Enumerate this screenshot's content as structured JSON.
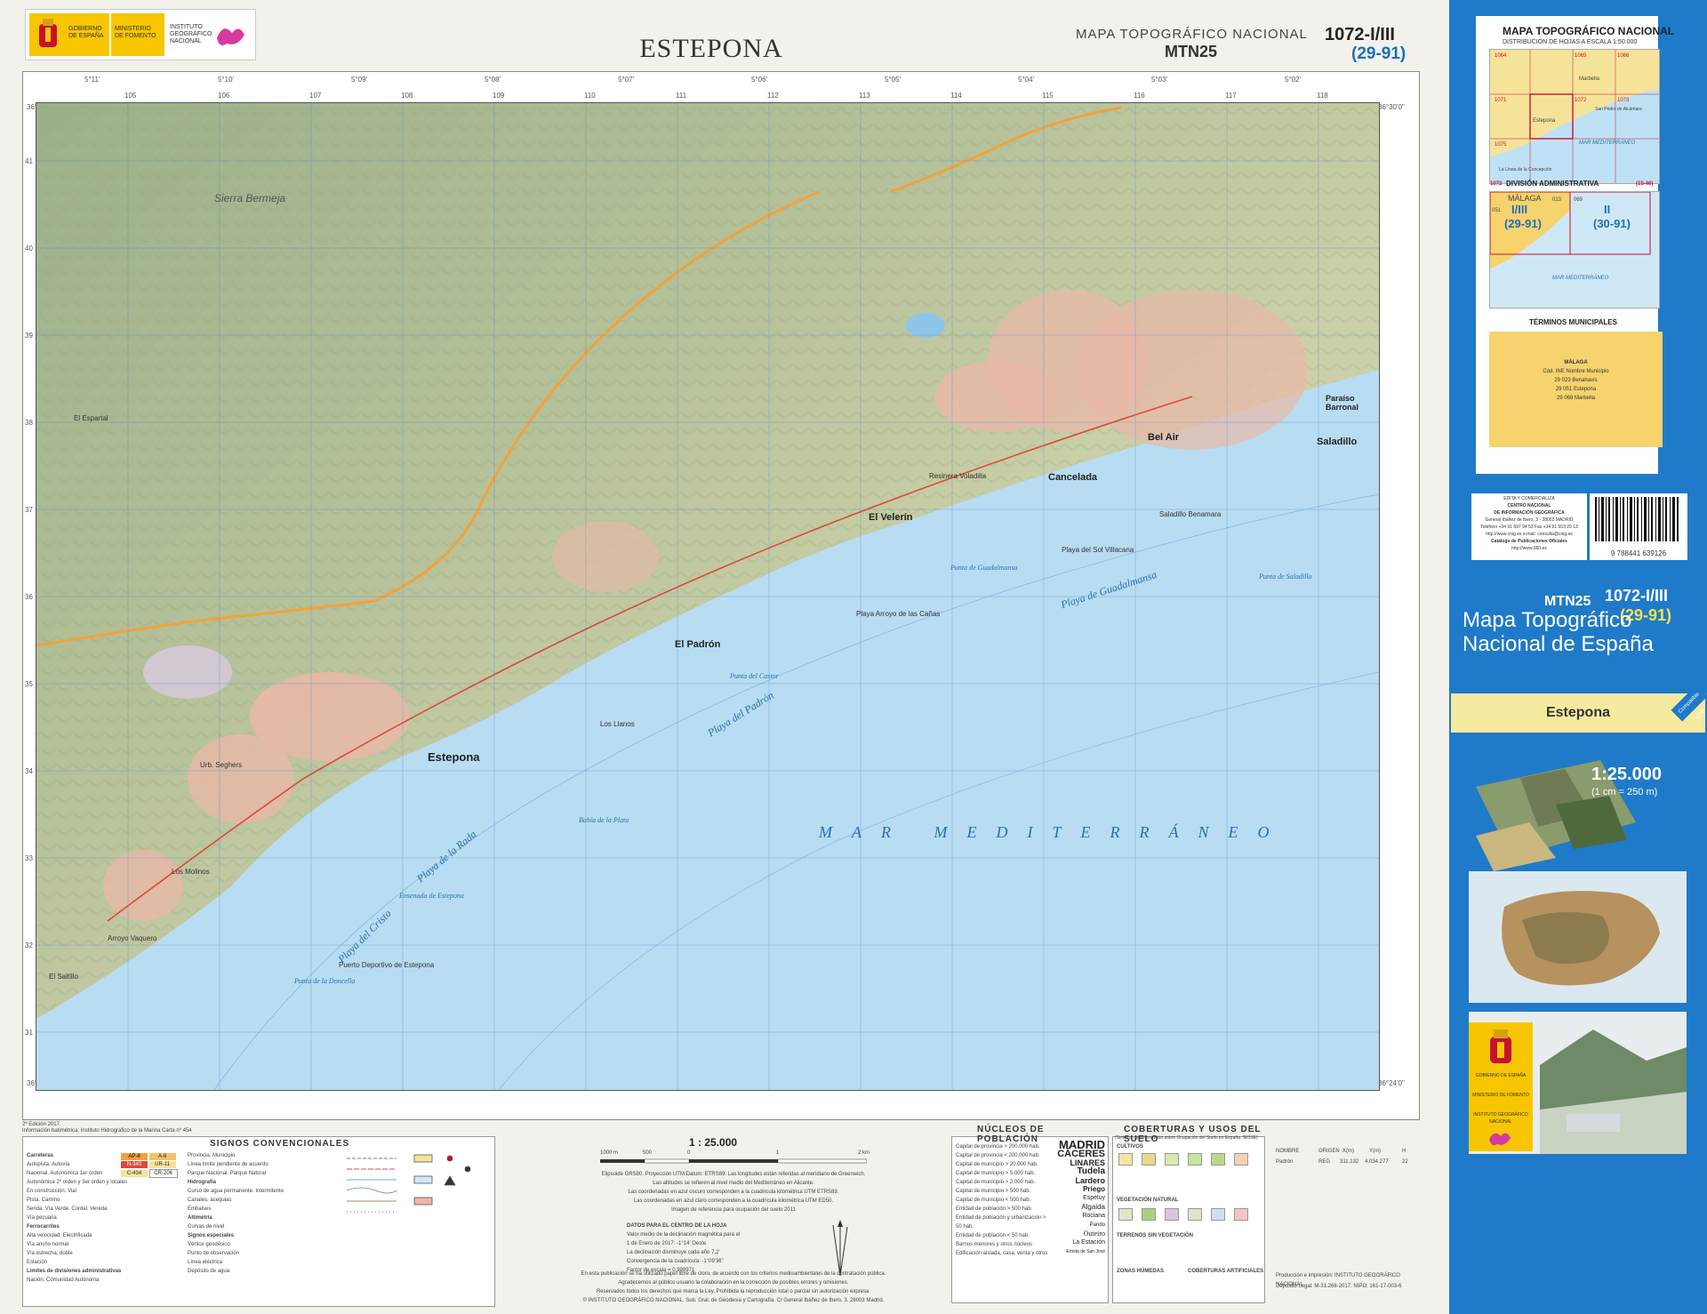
{
  "header": {
    "gov_line1": "GOBIERNO",
    "gov_line2": "DE ESPAÑA",
    "ministry": "MINISTERIO DE FOMENTO",
    "ign_line1": "INSTITUTO",
    "ign_line2": "GEOGRÁFICO",
    "ign_line3": "NACIONAL",
    "title": "ESTEPONA",
    "series_title": "MAPA TOPOGRÁFICO NACIONAL",
    "series_code": "MTN25",
    "sheet_number": "1072-I/III",
    "sheet_sub": "(29-91)"
  },
  "map": {
    "top_ticks": [
      "5°11'",
      "5°10'",
      "5°09'",
      "5°08'",
      "5°07'",
      "5°06'",
      "5°05'",
      "5°04'",
      "5°03'",
      "5°02'"
    ],
    "utm_top": [
      "105",
      "106",
      "107",
      "108",
      "109",
      "110",
      "111",
      "112",
      "113",
      "114",
      "115",
      "116",
      "117",
      "118"
    ],
    "left_ticks": [
      "41",
      "40",
      "39",
      "38",
      "37",
      "36",
      "35",
      "34",
      "33",
      "32",
      "31"
    ],
    "corner_tl": "36°30'0\"",
    "corner_tr": "36°30'0\"",
    "corner_bl": "36°24'0\"",
    "corner_br": "36°24'0\"",
    "places": [
      "Estepona",
      "El Padrón",
      "El Velerín",
      "Cancelada",
      "Bel Air",
      "Saladillo",
      "Resinera Voladilla",
      "Playa del Sol Villacana",
      "Saladillo Benamara",
      "Puerto Deportivo de Estepona",
      "Bahía de la Plata",
      "Punta del Castor",
      "Playa Arroyo de las Cañas",
      "Punta de Guadalmansa",
      "Los Llanos",
      "Ensenada de Estepona",
      "Urb. Seghers",
      "El Saltillo",
      "Arroyo Vaquero",
      "Paraíso Barronal",
      "Punta de Saladillo",
      "Punta de la Doncella",
      "Sierra Bermeja",
      "El Espartal",
      "Los Molinos"
    ],
    "sea_label": "MAR MEDITERRÁNEO",
    "playa_labels": [
      "Playa del Padrón",
      "Playa de Guadalmansa",
      "Playa de la Rada",
      "Playa del Cristo"
    ]
  },
  "legend": {
    "edition": "2ª Edición 2017.",
    "edition_note": "Información batimétrica: Instituto Hidrográfico de la Marina Carta nº 454",
    "signos_title": "SIGNOS CONVENCIONALES",
    "signos_left": [
      "Carreteras",
      "Autopista. Autovía",
      "Nacional. Autonómica 1er orden",
      "Autonómica 2º orden y 3er orden y locales",
      "En construcción. Vial",
      "Pista. Camino",
      "Senda. Vía Verde. Cordel. Vereda",
      "Vía pecuaria",
      "Ferrocarriles",
      "Alta velocidad. Electrificada",
      "Vía ancho normal",
      "Vía estrecha, doble",
      "Estación",
      "Límites de divisiones administrativas",
      "Nación. Comunidad Autónoma"
    ],
    "signos_mid": [
      "Provincia. Municipio",
      "Línea límite pendiente de acuerdo",
      "Parque Nacional. Parque Natural",
      "Hidrografía",
      "Curso de agua permanente. Intermitente",
      "Canales, acequias",
      "Embalses",
      "Altimetría",
      "Curvas de nivel",
      "Signos especiales",
      "Vértice geodésico",
      "Punto de observación",
      "Línea eléctrica",
      "Depósito de agua"
    ],
    "road_codes": [
      "AP-8",
      "A-8",
      "N-340",
      "UR-11",
      "C-434",
      "CR-206"
    ],
    "scale_title": "1 : 25.000",
    "scale_ticks": [
      "1000 m",
      "500",
      "0",
      "1",
      "2 km"
    ],
    "datum_text": [
      "Elipsoide GRS80. Proyección UTM Datum: ETRS89. Las longitudes están referidas al meridiano de Greenwich.",
      "Las altitudes se refieren al nivel medio del Mediterráneo en Alicante.",
      "Las coordenadas en azul oscuro corresponden a la cuadrícula kilométrica UTM ETRS89.",
      "Las coordenadas en azul claro corresponden a la cuadrícula kilométrica UTM ED50.",
      "Imagen de referencia para ocupación del suelo 2011"
    ],
    "magnetic_title": "DATOS PARA EL CENTRO DE LA HOJA",
    "magnetic_text": [
      "Valor medio de la declinación magnética para el",
      "1 de Enero de 2017: -1°14' Oeste",
      "La declinación disminuye cada año 7,2'",
      "Convergencia de la cuadrícula: -1°09'36\"",
      "Factor de escala = 0,999971"
    ],
    "publication_note": "En esta publicación se ha utilizado papel libre de cloro, de acuerdo con los criterios medioambientales de la contratación pública.",
    "thanks": "Agradecemos al público usuario la colaboración en la corrección de posibles errores y omisiones.",
    "rights": "Reservados todos los derechos que marca la Ley. Prohibida la reproducción total o parcial sin autorización expresa.",
    "copyright": "© INSTITUTO GEOGRÁFICO NACIONAL. Sub. Gral. de Geodesia y Cartografía. C/ General Ibáñez de Ibero, 3. 28003 Madrid.",
    "nucleos_title": "NÚCLEOS DE POBLACIÓN",
    "nucleos_rows": [
      "Capital de provincia > 200.000 hab.",
      "Capital de provincia < 200.000 hab.",
      "Capital de municipio > 20.000 hab.",
      "Capital de municipio > 5.000 hab.",
      "Capital de municipio > 2.000 hab.",
      "Capital de municipio > 500 hab.",
      "Capital de municipio < 500 hab.",
      "Entidad de población > 500 hab.",
      "Entidad de población y urbanización > 50 hab.",
      "Entidad de población < 50 hab.",
      "Barrios menores y otros núcleos",
      "Edificación aislada, casa, venta y otros"
    ],
    "nucleos_names": [
      "MADRID",
      "CÁCERES",
      "LINARES",
      "Tudela",
      "Lardero",
      "Priego",
      "Espeluy",
      "Algaida",
      "Rociana",
      "Pando",
      "Outeiro",
      "La Estación",
      "Ermita de San José"
    ],
    "cob_title": "COBERTURAS Y USOS DEL SUELO",
    "cob_sub": "(Sistema de Información sobre Ocupación del Suelo en España. SIOSE)",
    "cob_sections": [
      "CULTIVOS",
      "VEGETACIÓN NATURAL",
      "TERRENOS SIN VEGETACIÓN",
      "ZONAS HÚMEDAS",
      "COBERTURAS ARTIFICIALES"
    ],
    "cob_colors": [
      "#f3e6a5",
      "#e9d98a",
      "#d9e8b0",
      "#c9e3a2",
      "#b8d98b",
      "#f2d2b8",
      "#dfe8c6",
      "#a9d27f",
      "#d7c6e0",
      "#e8e0cf",
      "#cde0ef",
      "#f4c6c6"
    ],
    "nombre_headers": [
      "NOMBRE",
      "ORIGEN",
      "X(m)",
      "Y(m)",
      "H"
    ],
    "nombre_row": [
      "Padrón",
      "REG",
      "311.132",
      "4.034.277",
      "22"
    ],
    "production": "Producción e impresión: INSTITUTO GEOGRÁFICO NACIONAL",
    "deposito": "Depósito Legal: M-31.268-2017. NIPO: 161-17-003-6"
  },
  "panel": {
    "ov_title": "MAPA TOPOGRÁFICO NACIONAL",
    "ov_sub": "DISTRIBUCIÓN DE HOJAS A ESCALA 1:50.000",
    "ov_sheets": [
      "1064",
      "1065",
      "1066",
      "1071",
      "1072",
      "1073",
      "1075"
    ],
    "ov_places": [
      "Marbella",
      "Estepona",
      "San Pedro de Alcántara",
      "La Línea de la Concepción",
      "MAR MEDITERRÁNEO"
    ],
    "div_title": "DIVISIÓN ADMINISTRATIVA",
    "div_sheet": "1072",
    "div_sub": "(15-46)",
    "div_labels": [
      "MÁLAGA",
      "I/III",
      "(29-91)",
      "II",
      "(30-91)",
      "051",
      "023",
      "069",
      "MAR MEDITERRÁNEO"
    ],
    "term_title": "TÉRMINOS MUNICIPALES",
    "term_prov": "MÁLAGA",
    "term_rows": [
      "Cód. INE  Nombre Municipio",
      "29 023  Benahavís",
      "29 051  Estepona",
      "29 069  Marbella"
    ],
    "pub_lines": [
      "EDITA Y COMERCIALIZA",
      "CENTRO NACIONAL",
      "DE INFORMACIÓN GEOGRÁFICA",
      "General Ibáñez de Ibero, 3 - 28003 MADRID",
      "Teléfono +34 91 597 94 53  Fax +34 91 553 29 13",
      "http://www.cnig.es   e-mail: consulta@cnig.es",
      "Catálogo de Publicaciones Oficiales",
      "http://www.060.es"
    ],
    "isbn": "9 788441 639126",
    "cover_mtn": "MTN25",
    "cover_code": "1072-I/III",
    "cover_sub": "(29-91)",
    "cover_title": "Mapa Topográfico Nacional de España",
    "cover_place": "Estepona",
    "gps_badge": "Compatible GPS",
    "cover_scale": "1:25.000",
    "cover_scale_sub": "(1 cm = 250 m)",
    "gov_bottom": [
      "GOBIERNO DE ESPAÑA",
      "MINISTERIO DE FOMENTO",
      "INSTITUTO GEOGRÁFICO NACIONAL"
    ]
  }
}
